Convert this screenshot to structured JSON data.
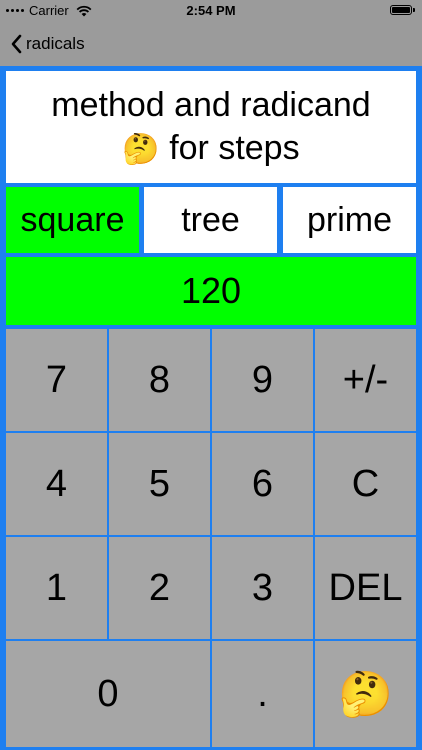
{
  "status_bar": {
    "carrier": "Carrier",
    "time": "2:54 PM"
  },
  "nav": {
    "back_label": "radicals"
  },
  "prompt": {
    "line1": "method and radicand",
    "emoji": "🤔",
    "line2": "for steps"
  },
  "methods": [
    {
      "label": "square",
      "selected": true
    },
    {
      "label": "tree",
      "selected": false
    },
    {
      "label": "prime",
      "selected": false
    }
  ],
  "display": {
    "value": "120"
  },
  "keypad": {
    "keys": [
      "7",
      "8",
      "9",
      "+/-",
      "4",
      "5",
      "6",
      "C",
      "1",
      "2",
      "3",
      "DEL",
      "0",
      ".",
      "🤔"
    ]
  },
  "colors": {
    "background": "#9b9b9b",
    "frame": "#1e7ff0",
    "highlight": "#00ff00",
    "key": "#a6a6a6"
  }
}
